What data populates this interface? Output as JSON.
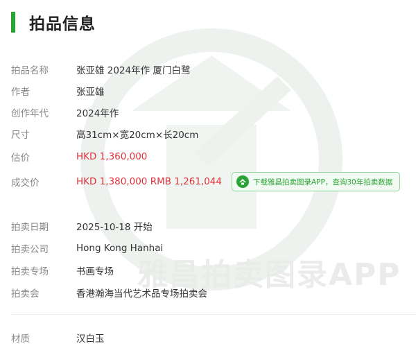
{
  "section": {
    "title": "拍品信息"
  },
  "fields": [
    {
      "label": "拍品名称",
      "value": "张亚雄 2024年作 厦门白鹭"
    },
    {
      "label": "作者",
      "value": "张亚雄"
    },
    {
      "label": "创作年代",
      "value": "2024年作"
    },
    {
      "label": "尺寸",
      "value": "高31cm×宽20cm×长20cm"
    },
    {
      "label": "估价",
      "value": "HKD 1,360,000"
    },
    {
      "label": "成交价",
      "value": "HKD 1,380,000 RMB 1,261,044"
    }
  ],
  "app_banner": {
    "text": "下载雅昌拍卖图录APP，查询30年拍卖数据"
  },
  "auction": [
    {
      "label": "拍卖日期",
      "value": "2025-10-18 开始"
    },
    {
      "label": "拍卖公司",
      "value": "Hong Kong Hanhai"
    },
    {
      "label": "拍卖专场",
      "value": "书画专场"
    },
    {
      "label": "拍卖会",
      "value": "香港瀚海当代艺术品专场拍卖会"
    }
  ],
  "material": {
    "label": "材质",
    "value": "汉白玉"
  },
  "watermark": {
    "text": "雅昌拍卖图录APP"
  },
  "colors": {
    "accent": "#2aa335",
    "price": "#e0313a",
    "label": "#888888",
    "value": "#333333"
  }
}
